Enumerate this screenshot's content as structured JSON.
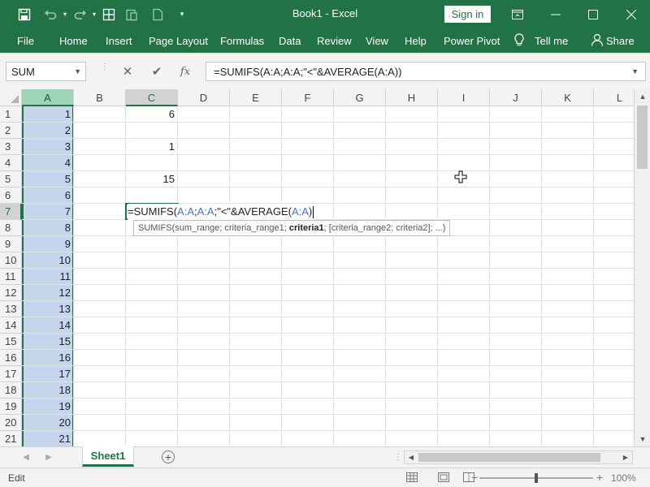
{
  "window": {
    "title": "Book1  -  Excel",
    "sign_in": "Sign in"
  },
  "ribbon": {
    "tabs": [
      "File",
      "Home",
      "Insert",
      "Page Layout",
      "Formulas",
      "Data",
      "Review",
      "View",
      "Help",
      "Power Pivot",
      "Tell me",
      "Share"
    ]
  },
  "formula_bar": {
    "name_box": "SUM",
    "cancel_glyph": "✕",
    "enter_glyph": "✔",
    "fx_label": "fx",
    "formula": "=SUMIFS(A:A;A:A;\"<\"&AVERAGE(A:A))"
  },
  "grid": {
    "columns": [
      "A",
      "B",
      "C",
      "D",
      "E",
      "F",
      "G",
      "H",
      "I",
      "J",
      "K",
      "L"
    ],
    "rows": [
      "1",
      "2",
      "3",
      "4",
      "5",
      "6",
      "7",
      "8",
      "9",
      "10",
      "11",
      "12",
      "13",
      "14",
      "15",
      "16",
      "17",
      "18",
      "19",
      "20",
      "21"
    ],
    "column_a_values": [
      "1",
      "2",
      "3",
      "4",
      "5",
      "6",
      "7",
      "8",
      "9",
      "10",
      "11",
      "12",
      "13",
      "14",
      "15",
      "16",
      "17",
      "18",
      "19",
      "20",
      "21"
    ],
    "column_c_values": [
      {
        "row": 1,
        "value": "6"
      },
      {
        "row": 3,
        "value": "1"
      },
      {
        "row": 5,
        "value": "15"
      }
    ],
    "selected_column": "C",
    "active_row": "7"
  },
  "editing": {
    "prefix": "=SUMIFS(",
    "ref1": "A:A",
    "sep1": ";",
    "ref2": "A:A",
    "mid": ";\"<\"&AVERAGE(",
    "ref3": "A:A",
    "suffix": ")",
    "tooltip_fn": "SUMIFS(sum_range; criteria_range1; ",
    "tooltip_bold": "criteria1",
    "tooltip_rest": "; [criteria_range2; criteria2]; ...)"
  },
  "sheets": {
    "tabs": [
      "Sheet1"
    ],
    "add_glyph": "+"
  },
  "status": {
    "mode": "Edit",
    "zoom": "100%"
  },
  "colors": {
    "brand": "#217346",
    "selection": "#c5d5ec",
    "ref": "#4472c4"
  }
}
